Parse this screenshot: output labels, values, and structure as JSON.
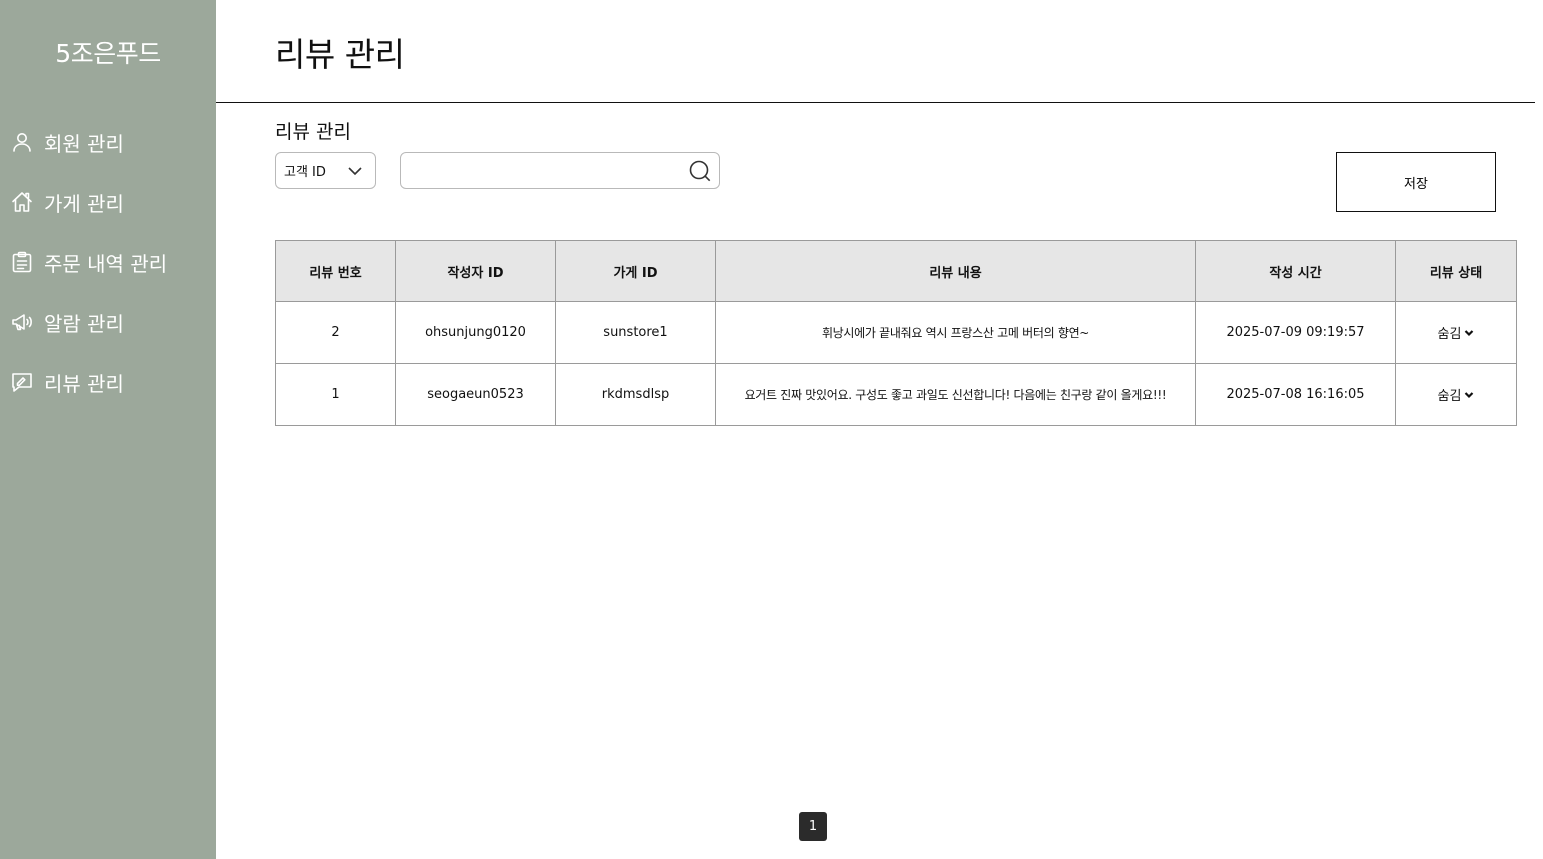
{
  "sidebar": {
    "brand": "5조은푸드",
    "bg_color": "#9ca89b",
    "items": [
      {
        "label": "회원 관리",
        "icon": "user-icon"
      },
      {
        "label": "가게 관리",
        "icon": "home-icon"
      },
      {
        "label": "주문 내역 관리",
        "icon": "clipboard-icon"
      },
      {
        "label": "알람 관리",
        "icon": "megaphone-icon"
      },
      {
        "label": "리뷰 관리",
        "icon": "review-icon"
      }
    ]
  },
  "header": {
    "title": "리뷰 관리"
  },
  "filter": {
    "section_title": "리뷰 관리",
    "select_value": "고객 ID",
    "search_value": "",
    "search_icon": "search-icon",
    "save_label": "저장"
  },
  "table": {
    "headers": [
      "리뷰 번호",
      "작성자 ID",
      "가게 ID",
      "리뷰 내용",
      "작성 시간",
      "리뷰 상태"
    ],
    "rows": [
      {
        "no": "2",
        "writer": "ohsunjung0120",
        "store": "sunstore1",
        "content": "휘낭시에가 끝내줘요 역시 프랑스산 고메 버터의 향연~",
        "time": "2025-07-09 09:19:57",
        "status": "숨김"
      },
      {
        "no": "1",
        "writer": "seogaeun0523",
        "store": "rkdmsdlsp",
        "content": "요거트 진짜 맛있어요. 구성도 좋고 과일도 신선합니다! 다음에는 친구랑 같이 올게요!!!",
        "time": "2025-07-08 16:16:05",
        "status": "숨김"
      }
    ]
  },
  "pagination": {
    "current": "1"
  }
}
